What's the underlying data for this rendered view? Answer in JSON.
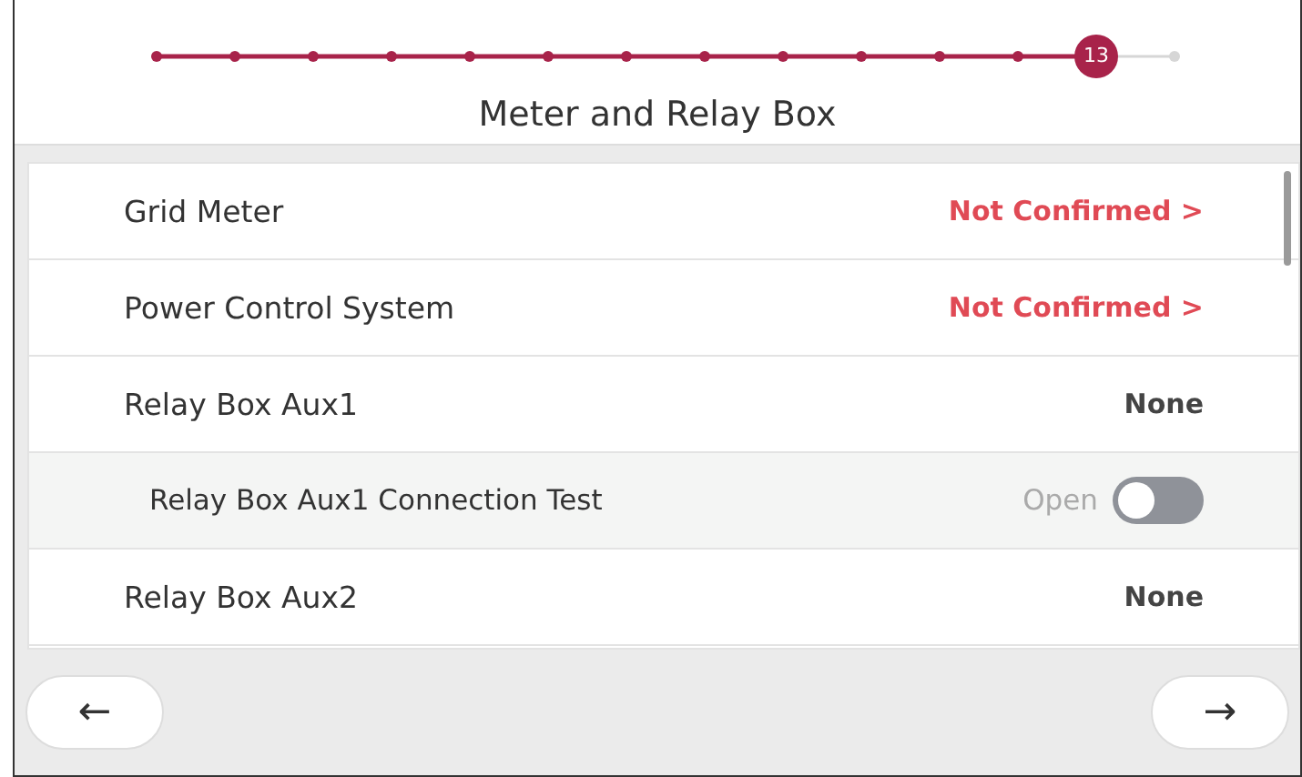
{
  "progress": {
    "steps": [
      {
        "completed": true,
        "selected": false
      },
      {
        "completed": true,
        "selected": false
      },
      {
        "completed": true,
        "selected": false
      },
      {
        "completed": true,
        "selected": false
      },
      {
        "completed": true,
        "selected": false
      },
      {
        "completed": true,
        "selected": false
      },
      {
        "completed": true,
        "selected": false
      },
      {
        "completed": true,
        "selected": false
      },
      {
        "completed": true,
        "selected": false
      },
      {
        "completed": true,
        "selected": false
      },
      {
        "completed": true,
        "selected": false
      },
      {
        "completed": true,
        "selected": false
      },
      {
        "completed": true,
        "selected": true,
        "label": "13"
      },
      {
        "completed": false,
        "selected": false
      }
    ]
  },
  "title": "Meter and Relay Box",
  "rows": [
    {
      "kind": "link",
      "label": "Grid Meter",
      "value": "Not Confirmed >"
    },
    {
      "kind": "link",
      "label": "Power Control System",
      "value": "Not Confirmed >"
    },
    {
      "kind": "value",
      "label": "Relay Box Aux1",
      "value": "None"
    },
    {
      "kind": "toggle",
      "label": "Relay Box Aux1 Connection Test",
      "value": "Open",
      "on": false
    },
    {
      "kind": "value",
      "label": "Relay Box Aux2",
      "value": "None"
    }
  ],
  "nav": {
    "back": "←",
    "next": "→"
  }
}
